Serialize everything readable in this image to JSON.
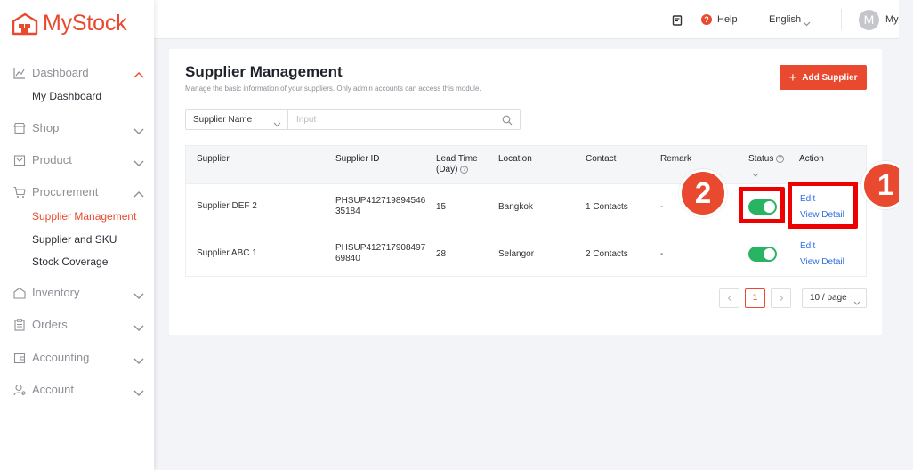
{
  "app": {
    "name": "MyStock"
  },
  "sidebar": {
    "sections": [
      {
        "label": "Dashboard",
        "icon": "chart-line-icon",
        "expanded": true,
        "items": [
          "My Dashboard"
        ]
      },
      {
        "label": "Shop",
        "icon": "storefront-icon",
        "expanded": false,
        "items": []
      },
      {
        "label": "Product",
        "icon": "box-icon",
        "expanded": false,
        "items": []
      },
      {
        "label": "Procurement",
        "icon": "cart-icon",
        "expanded": true,
        "items": [
          "Supplier Management",
          "Supplier and SKU",
          "Stock Coverage"
        ]
      },
      {
        "label": "Inventory",
        "icon": "warehouse-icon",
        "expanded": false,
        "items": []
      },
      {
        "label": "Orders",
        "icon": "clipboard-icon",
        "expanded": false,
        "items": []
      },
      {
        "label": "Accounting",
        "icon": "wallet-icon",
        "expanded": false,
        "items": []
      },
      {
        "label": "Account",
        "icon": "user-icon",
        "expanded": false,
        "items": []
      }
    ],
    "active_item": "Supplier Management"
  },
  "header": {
    "help_label": "Help",
    "language": "English",
    "avatar_initial": "M",
    "user_label": "My"
  },
  "page": {
    "title": "Supplier Management",
    "description": "Manage the basic information of your suppliers. Only admin accounts can access this module.",
    "add_button_label": "Add Supplier",
    "filter": {
      "field": "Supplier Name",
      "placeholder": "Input"
    }
  },
  "table": {
    "columns": [
      "Supplier",
      "Supplier ID",
      "Lead Time\n(Day)",
      "Location",
      "Contact",
      "Remark",
      "Status",
      "Action"
    ],
    "lead_time_line1": "Lead Time",
    "lead_time_line2": "(Day)",
    "rows": [
      {
        "supplier": "Supplier DEF 2",
        "id_line1": "PHSUP412719894546",
        "id_line2": "35184",
        "lead_time": "15",
        "location": "Bangkok",
        "contact": "1 Contacts",
        "remark": "-",
        "status_on": true,
        "edit": "Edit",
        "view": "View Detail"
      },
      {
        "supplier": "Supplier ABC 1",
        "id_line1": "PHSUP412717908497",
        "id_line2": "69840",
        "lead_time": "28",
        "location": "Selangor",
        "contact": "2 Contacts",
        "remark": "-",
        "status_on": true,
        "edit": "Edit",
        "view": "View Detail"
      }
    ]
  },
  "pagination": {
    "current_page": "1",
    "page_size": "10 / page"
  },
  "annotations": {
    "badge_1": "1",
    "badge_2": "2"
  },
  "colors": {
    "accent": "#e8492f",
    "toggle_on": "#28b463",
    "highlight": "#ee0000",
    "link": "#2f6fde"
  }
}
